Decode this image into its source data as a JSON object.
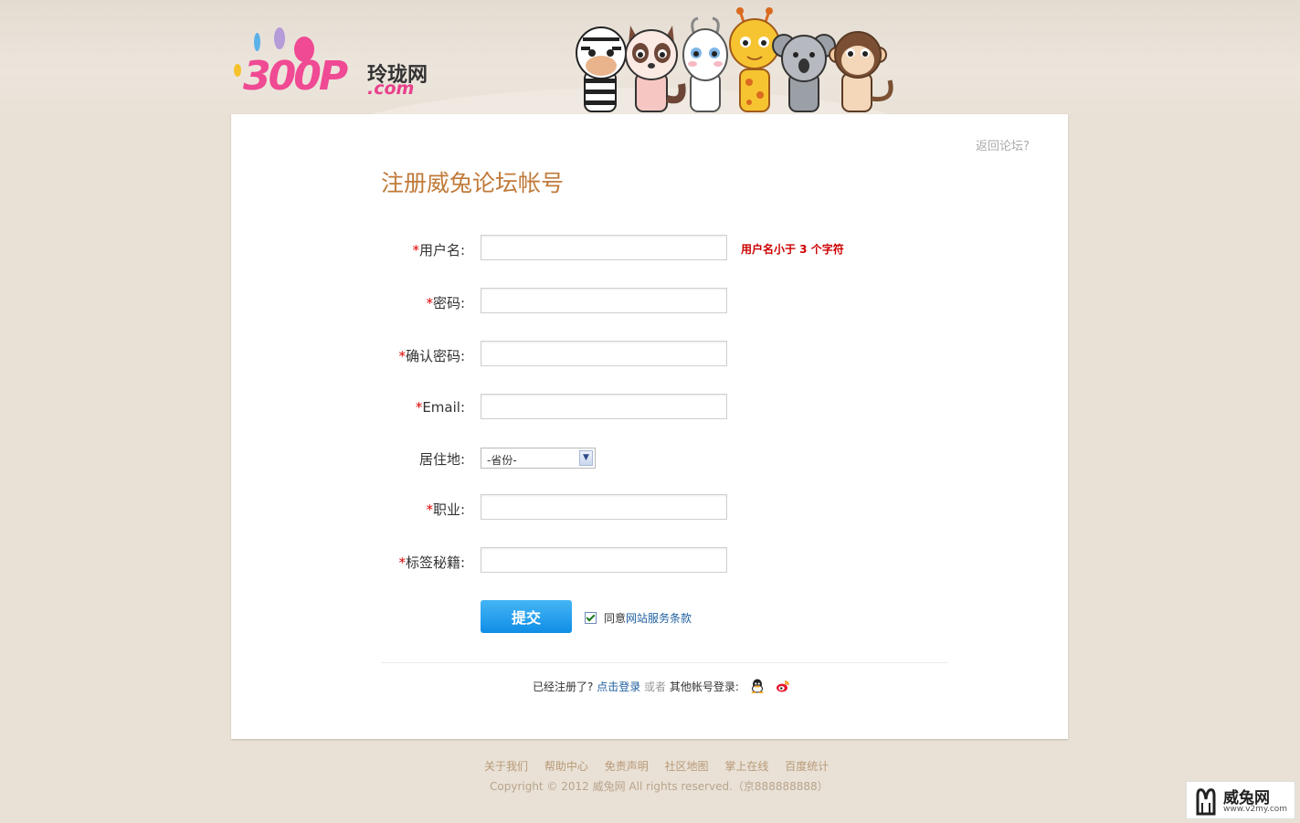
{
  "header": {
    "logo_number": "300P",
    "logo_cn": "玲珑网",
    "logo_com": ".com"
  },
  "card": {
    "back_link": "返回论坛?",
    "title": "注册威兔论坛帐号"
  },
  "form": {
    "username": {
      "label": "用户名:",
      "required": "*",
      "value": "",
      "error": "用户名小于 3 个字符"
    },
    "password": {
      "label": "密码:",
      "required": "*",
      "value": ""
    },
    "confirm_password": {
      "label": "确认密码:",
      "required": "*",
      "value": ""
    },
    "email": {
      "label": "Email:",
      "required": "*",
      "value": ""
    },
    "residence": {
      "label": "居住地:",
      "selected": "-省份-"
    },
    "occupation": {
      "label": "职业:",
      "required": "*",
      "value": ""
    },
    "tags": {
      "label": "标签秘籍:",
      "required": "*",
      "value": ""
    },
    "submit_label": "提交",
    "agree_prefix": "同意",
    "terms_link": "网站服务条款"
  },
  "login": {
    "prompt": "已经注册了?",
    "link": "点击登录",
    "or": "或者",
    "other": "其他帐号登录:"
  },
  "footer": {
    "links": [
      "关于我们",
      "帮助中心",
      "免责声明",
      "社区地图",
      "掌上在线",
      "百度统计"
    ],
    "copyright": "Copyright © 2012 威兔网 All rights reserved.（京888888888）"
  },
  "badge": {
    "name": "威兔网",
    "url": "www.v2my.com"
  },
  "colors": {
    "title": "#c07a3a",
    "required": "#dd0000",
    "error": "#cc0000",
    "submit": "#1a9aec",
    "link": "#1f5f9f",
    "logo_pink": "#ef4a93"
  }
}
